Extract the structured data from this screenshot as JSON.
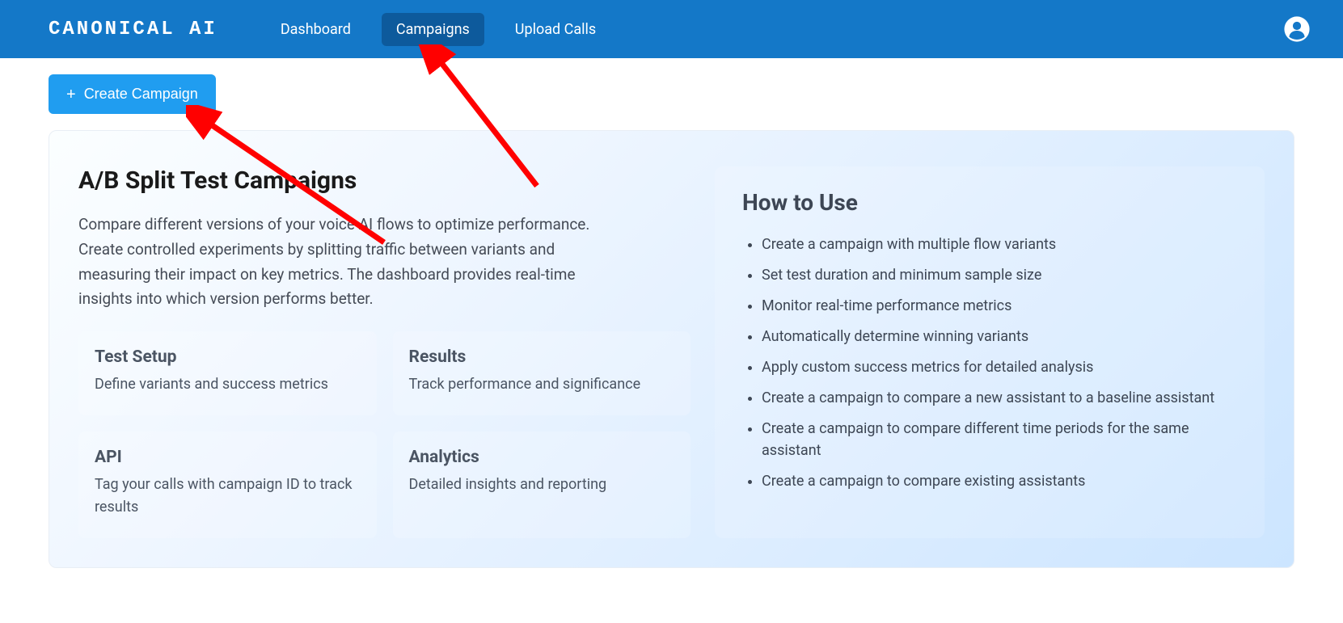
{
  "header": {
    "logo": "CANONICAL AI",
    "nav": [
      {
        "label": "Dashboard",
        "active": false
      },
      {
        "label": "Campaigns",
        "active": true
      },
      {
        "label": "Upload Calls",
        "active": false
      }
    ]
  },
  "create_button": "Create Campaign",
  "main": {
    "title": "A/B Split Test Campaigns",
    "description": "Compare different versions of your voice AI flows to optimize performance. Create controlled experiments by splitting traffic between variants and measuring their impact on key metrics. The dashboard provides real-time insights into which version performs better.",
    "tiles": [
      {
        "title": "Test Setup",
        "text": "Define variants and success metrics"
      },
      {
        "title": "Results",
        "text": "Track performance and significance"
      },
      {
        "title": "API",
        "text": "Tag your calls with campaign ID to track results"
      },
      {
        "title": "Analytics",
        "text": "Detailed insights and reporting"
      }
    ]
  },
  "howto": {
    "title": "How to Use",
    "items": [
      "Create a campaign with multiple flow variants",
      "Set test duration and minimum sample size",
      "Monitor real-time performance metrics",
      "Automatically determine winning variants",
      "Apply custom success metrics for detailed analysis",
      "Create a campaign to compare a new assistant to a baseline assistant",
      "Create a campaign to compare different time periods for the same assistant",
      "Create a campaign to compare existing assistants"
    ]
  }
}
